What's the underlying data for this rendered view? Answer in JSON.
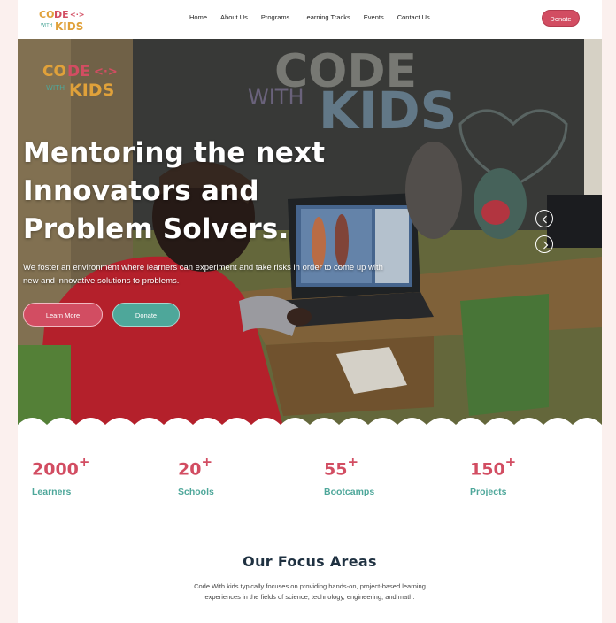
{
  "nav": {
    "logo_text": "CODE WITH KIDS",
    "items": [
      "Home",
      "About Us",
      "Programs",
      "Learning Tracks",
      "Events",
      "Contact Us"
    ],
    "donate_label": "Donate"
  },
  "hero": {
    "title": "Mentoring the next Innovators and Problem Solvers.",
    "subtitle": "We foster an environment where learners can experiment and take risks in order to come up with new and innovative solutions to problems.",
    "learn_more_label": "Learn More",
    "donate_label": "Donate",
    "chalkboard_text": "CODE WITH KIDS"
  },
  "stats": [
    {
      "value": "2000",
      "suffix": "+",
      "label": "Learners"
    },
    {
      "value": "20",
      "suffix": "+",
      "label": "Schools"
    },
    {
      "value": "55",
      "suffix": "+",
      "label": "Bootcamps"
    },
    {
      "value": "150",
      "suffix": "+",
      "label": "Projects"
    }
  ],
  "focus": {
    "title": "Our Focus Areas",
    "text": "Code With kids typically focuses on providing hands-on, project-based learning experiences in the fields of science, technology, engineering, and math."
  },
  "colors": {
    "primary": "#d24d62",
    "secondary": "#4ea79a",
    "heading": "#1f3141",
    "background": "#fbf0ee"
  },
  "icons": {
    "prev": "chevron-left-icon",
    "next": "chevron-right-icon"
  }
}
